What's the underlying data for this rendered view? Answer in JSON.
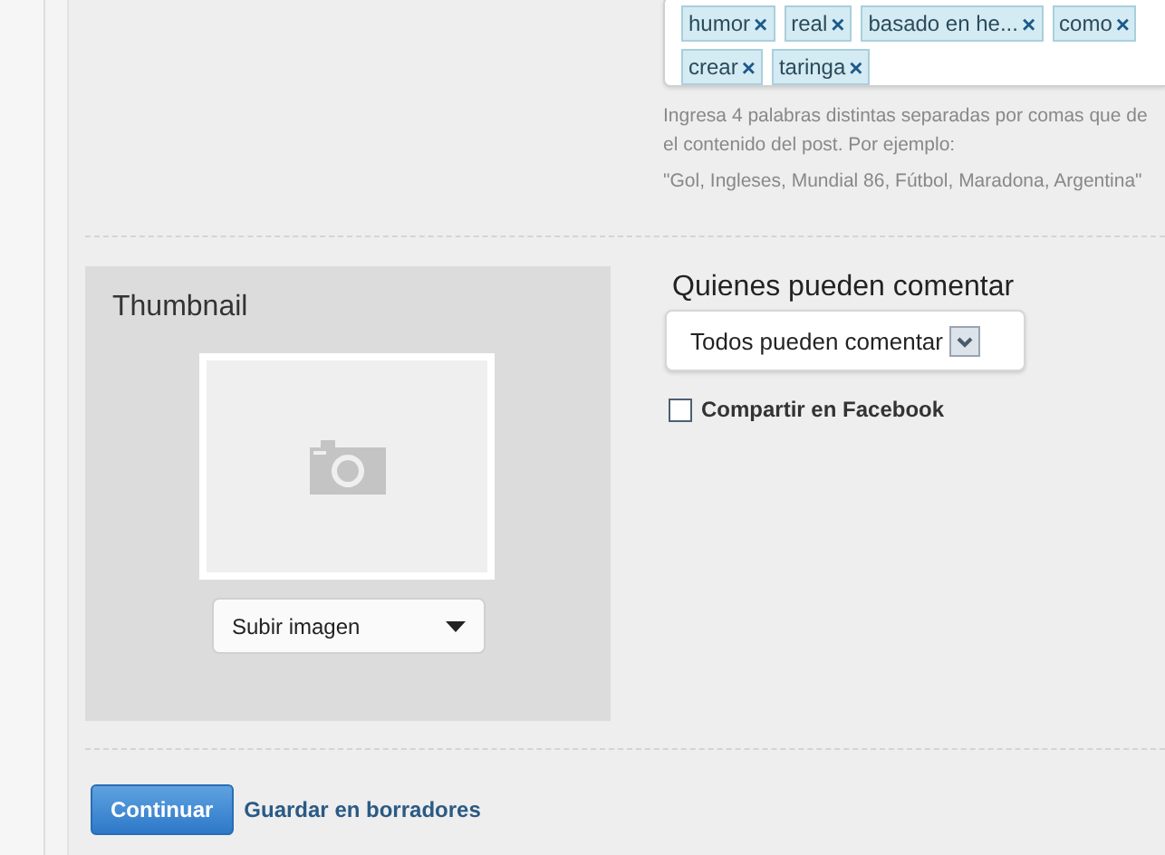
{
  "tags": [
    {
      "label": "humor",
      "remove": "×"
    },
    {
      "label": "real",
      "remove": "×"
    },
    {
      "label": "basado en he...",
      "remove": "×"
    },
    {
      "label": "como",
      "remove": "×"
    },
    {
      "label": "crear",
      "remove": "×"
    },
    {
      "label": "taringa",
      "remove": "×"
    }
  ],
  "tags_help": "Ingresa 4 palabras distintas separadas por comas que de el contenido del post. Por ejemplo:",
  "tags_example": "\"Gol, Ingleses, Mundial 86, Fútbol, Maradona, Argentina\"",
  "thumbnail": {
    "title": "Thumbnail",
    "upload_button": "Subir imagen"
  },
  "comments": {
    "title": "Quienes pueden comentar",
    "select_value": "Todos pueden comentar"
  },
  "share_facebook": {
    "label": "Compartir en Facebook",
    "checked": false
  },
  "buttons": {
    "continue": "Continuar",
    "save_draft": "Guardar en borradores"
  }
}
